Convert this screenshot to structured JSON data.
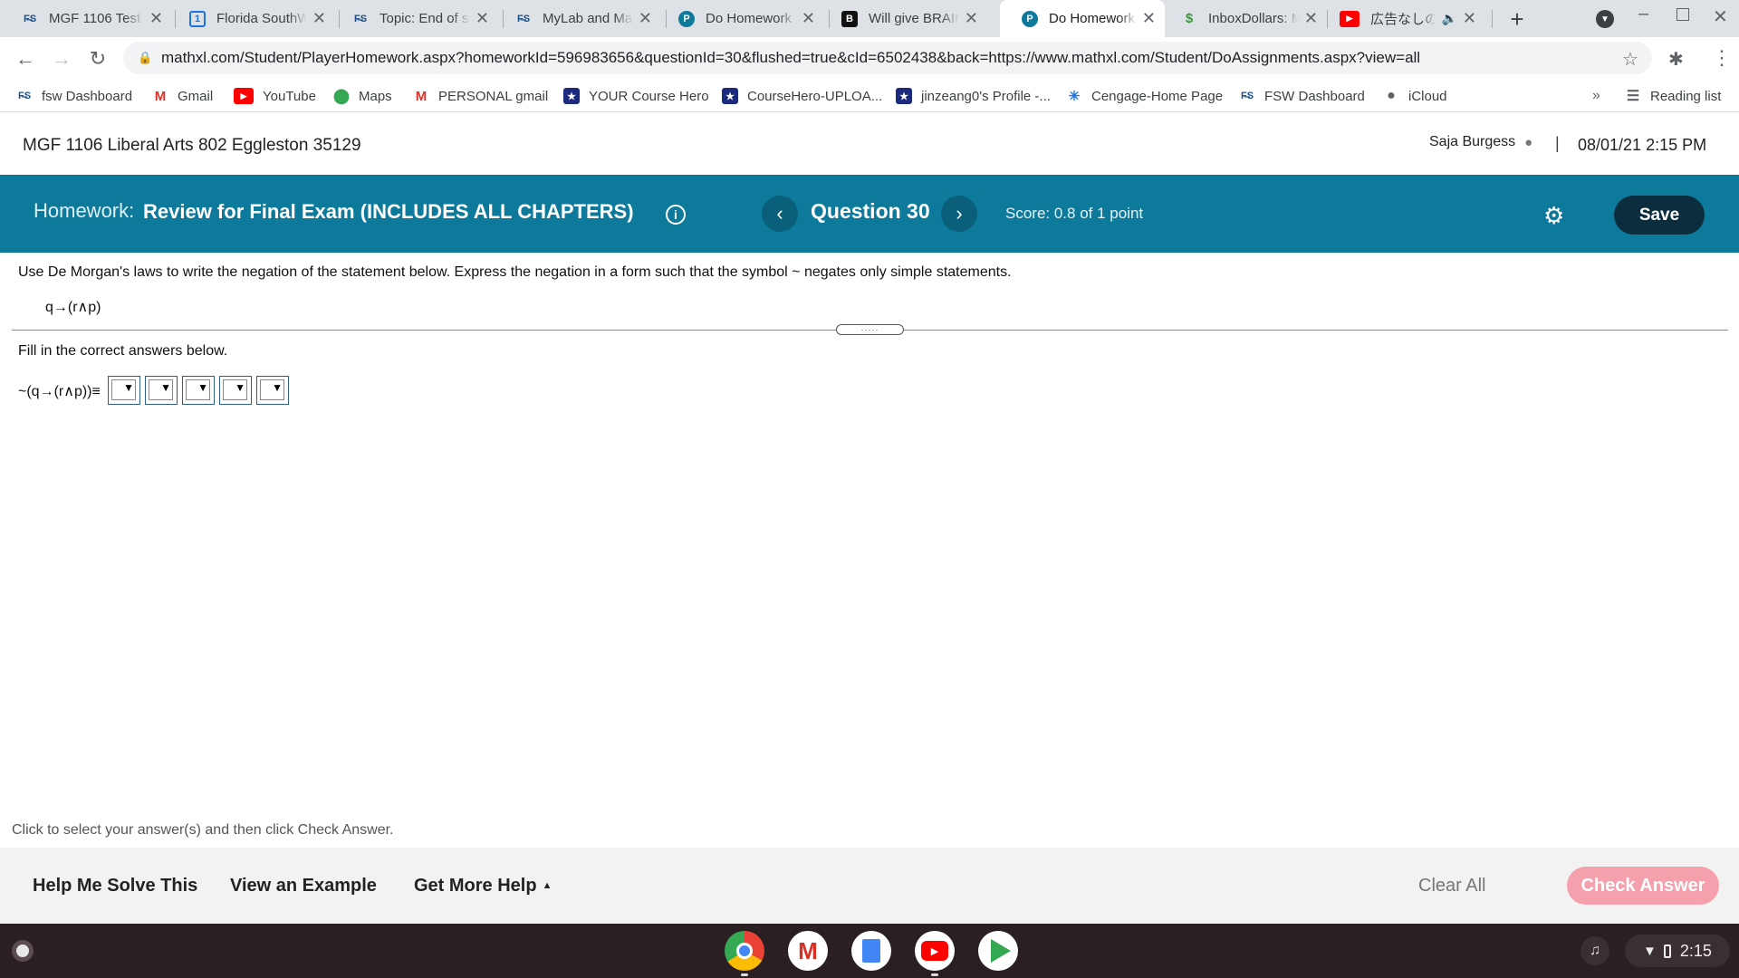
{
  "browser": {
    "tabs": [
      {
        "title": "MGF 1106 Test",
        "icon": "fsw-logo-icon",
        "active": false
      },
      {
        "title": "Florida SouthW",
        "icon": "calendar-icon",
        "active": false
      },
      {
        "title": "Topic: End of se",
        "icon": "fsw-logo-icon",
        "active": false
      },
      {
        "title": "MyLab and Ma",
        "icon": "fsw-logo-icon",
        "active": false
      },
      {
        "title": "Do Homework",
        "icon": "pearson-icon",
        "active": false
      },
      {
        "title": "Will give BRAIN",
        "icon": "brainly-icon",
        "active": false
      },
      {
        "title": "Do Homework",
        "icon": "pearson-icon",
        "active": true
      },
      {
        "title": "InboxDollars: M",
        "icon": "inboxdollars-icon",
        "active": false
      },
      {
        "title": "広告なしの",
        "icon": "youtube-icon",
        "active": false
      }
    ],
    "url": "mathxl.com/Student/PlayerHomework.aspx?homeworkId=596983656&questionId=30&flushed=true&cId=6502438&back=https://www.mathxl.com/Student/DoAssignments.aspx?view=all",
    "bookmarks": [
      {
        "label": "fsw Dashboard",
        "icon": "fsw-logo-icon"
      },
      {
        "label": "Gmail",
        "icon": "gmail-icon"
      },
      {
        "label": "YouTube",
        "icon": "youtube-icon"
      },
      {
        "label": "Maps",
        "icon": "maps-icon"
      },
      {
        "label": "PERSONAL gmail",
        "icon": "gmail-icon"
      },
      {
        "label": "YOUR Course Hero",
        "icon": "coursehero-icon"
      },
      {
        "label": "CourseHero-UPLOA...",
        "icon": "coursehero-icon"
      },
      {
        "label": "jinzeang0's Profile -...",
        "icon": "coursehero-icon"
      },
      {
        "label": "Cengage-Home Page",
        "icon": "cengage-icon"
      },
      {
        "label": "FSW Dashboard",
        "icon": "fsw-logo-icon"
      },
      {
        "label": "iCloud",
        "icon": "apple-icon"
      }
    ],
    "overflow_label": "»",
    "reading_list": "Reading list"
  },
  "course": {
    "title": "MGF 1106 Liberal Arts 802 Eggleston 35129",
    "user": "Saja Burgess",
    "separator": "|",
    "datetime": "08/01/21 2:15 PM"
  },
  "homework": {
    "prefix": "Homework:",
    "title": "Review for Final Exam (INCLUDES ALL CHAPTERS)",
    "question": "Question 30",
    "score": "Score: 0.8 of 1 point",
    "save_label": "Save"
  },
  "question": {
    "instructions": "Use De Morgan's laws to write the negation of the statement below. Express the negation in a form such that the symbol ~ negates only simple statements.",
    "statement": "q→(r∧p)",
    "fill_prompt": "Fill in the correct answers below.",
    "expression": "~(q→(r∧p))≡",
    "dropdown_count": 5,
    "hint": "Click to select your answer(s) and then click Check Answer."
  },
  "bottom": {
    "help_me_solve": "Help Me Solve This",
    "view_example": "View an Example",
    "get_more_help": "Get More Help",
    "clear_all": "Clear All",
    "check_answer": "Check Answer"
  },
  "shelf": {
    "time": "2:15",
    "apps": [
      "chrome-icon",
      "gmail-icon",
      "docs-icon",
      "youtube-icon",
      "play-store-icon"
    ]
  },
  "colors": {
    "header_teal": "#0d7a9c",
    "save_navy": "#0b2d3d",
    "check_answer_pink": "#f4a0ad"
  }
}
